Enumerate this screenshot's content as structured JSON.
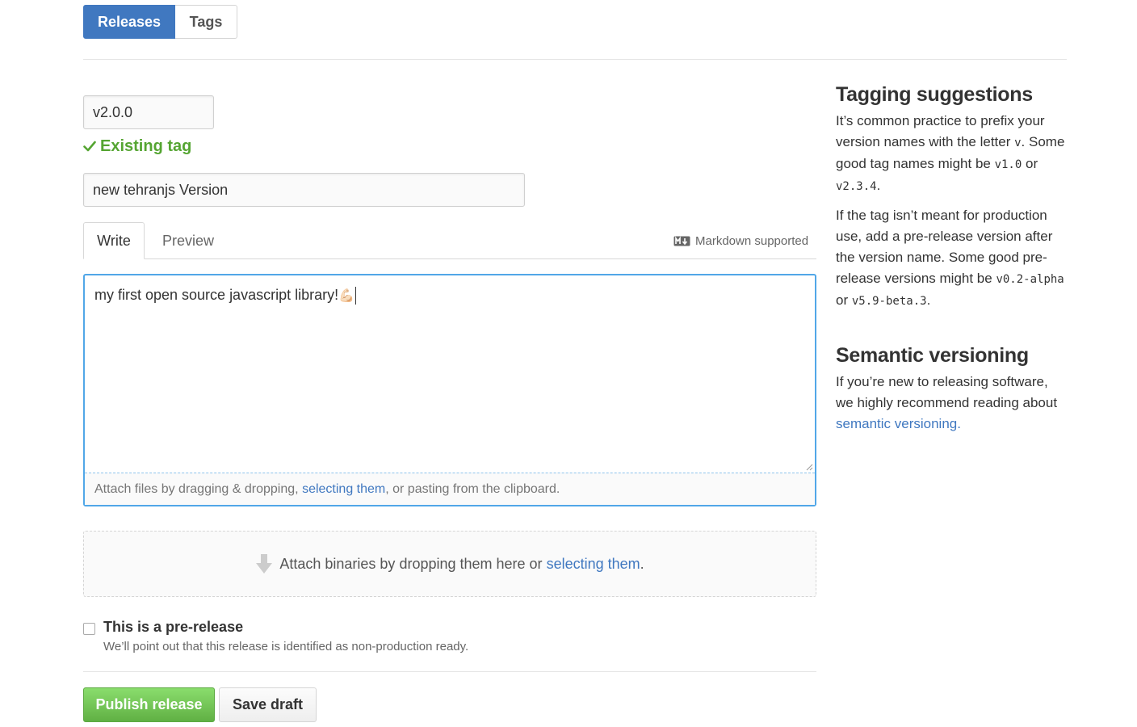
{
  "subnav": {
    "releases": "Releases",
    "tags": "Tags"
  },
  "form": {
    "tag_value": "v2.0.0",
    "existing_tag": "Existing tag",
    "title_value": "new tehranjs Version",
    "tabs": {
      "write": "Write",
      "preview": "Preview"
    },
    "markdown_hint": "Markdown supported",
    "body_text": "my first open source javascript library!",
    "body_emoji": "💪🏻",
    "attach_prefix": "Attach files by dragging & dropping, ",
    "attach_link": "selecting them",
    "attach_suffix": ", or pasting from the clipboard.",
    "binaries_prefix": "Attach binaries by dropping them here or ",
    "binaries_link": "selecting them",
    "binaries_suffix": ".",
    "prerelease_label": "This is a pre-release",
    "prerelease_note": "We’ll point out that this release is identified as non-production ready.",
    "prerelease_checked": false,
    "publish": "Publish release",
    "save_draft": "Save draft"
  },
  "sidebar": {
    "tagging_title": "Tagging suggestions",
    "p1_a": "It’s common practice to prefix your version names with the letter ",
    "p1_code1": "v",
    "p1_b": ". Some good tag names might be ",
    "p1_code2": "v1.0",
    "p1_c": " or ",
    "p1_code3": "v2.3.4",
    "p1_d": ".",
    "p2_a": "If the tag isn’t meant for production use, add a pre-release version after the version name. Some good pre-release versions might be ",
    "p2_code1": "v0.2-alpha",
    "p2_b": " or ",
    "p2_code2": "v5.9-beta.3",
    "p2_c": ".",
    "semver_title": "Semantic versioning",
    "p3_a": "If you’re new to releasing software, we highly recommend reading about ",
    "p3_link": "semantic versioning."
  },
  "colors": {
    "accent": "#4078c0",
    "success": "#55a532",
    "focus": "#51a7e8",
    "primary_button": "#60b044"
  }
}
